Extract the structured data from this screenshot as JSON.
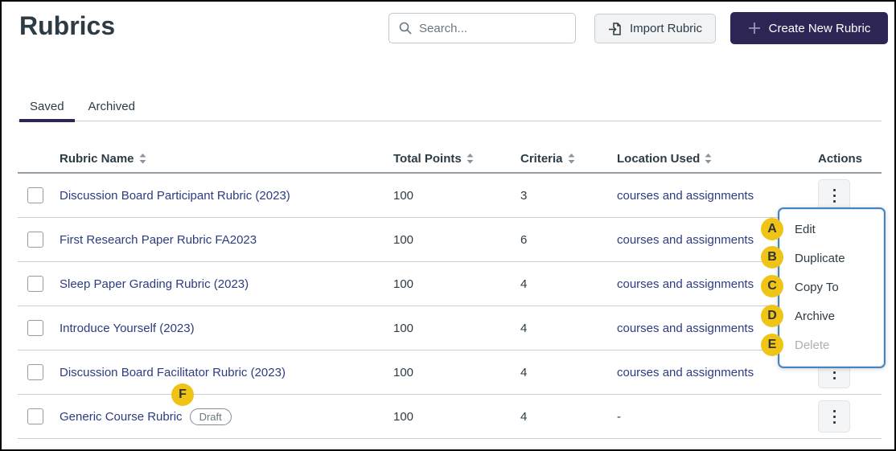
{
  "page": {
    "title": "Rubrics"
  },
  "toolbar": {
    "search_placeholder": "Search...",
    "import_button": "Import Rubric",
    "create_button": "Create New Rubric"
  },
  "tabs": [
    {
      "label": "Saved",
      "active": true
    },
    {
      "label": "Archived",
      "active": false
    }
  ],
  "table": {
    "columns": [
      {
        "label": "Rubric Name",
        "sortable": true
      },
      {
        "label": "Total Points",
        "sortable": true
      },
      {
        "label": "Criteria",
        "sortable": true
      },
      {
        "label": "Location Used",
        "sortable": true
      },
      {
        "label": "Actions",
        "sortable": false
      }
    ],
    "rows": [
      {
        "name": "Discussion Board Participant Rubric (2023)",
        "total_points": "100",
        "criteria": "3",
        "location_used": "courses and assignments"
      },
      {
        "name": "First Research Paper Rubric FA2023",
        "total_points": "100",
        "criteria": "6",
        "location_used": "courses and assignments"
      },
      {
        "name": "Sleep Paper Grading Rubric (2023)",
        "total_points": "100",
        "criteria": "4",
        "location_used": "courses and assignments"
      },
      {
        "name": "Introduce Yourself (2023)",
        "total_points": "100",
        "criteria": "4",
        "location_used": "courses and assignments"
      },
      {
        "name": "Discussion Board Facilitator Rubric (2023)",
        "total_points": "100",
        "criteria": "4",
        "location_used": "courses and assignments"
      },
      {
        "name": "Generic Course Rubric",
        "badge": "Draft",
        "total_points": "100",
        "criteria": "4",
        "location_used": "-"
      }
    ]
  },
  "actions_menu": {
    "items": [
      {
        "label": "Edit",
        "disabled": false
      },
      {
        "label": "Duplicate",
        "disabled": false
      },
      {
        "label": "Copy To",
        "disabled": false
      },
      {
        "label": "Archive",
        "disabled": false
      },
      {
        "label": "Delete",
        "disabled": true
      }
    ]
  },
  "annotations": {
    "markers": [
      {
        "letter": "A",
        "target": "Edit"
      },
      {
        "letter": "B",
        "target": "Duplicate"
      },
      {
        "letter": "C",
        "target": "Copy To"
      },
      {
        "letter": "D",
        "target": "Archive"
      },
      {
        "letter": "E",
        "target": "Delete"
      },
      {
        "letter": "F",
        "target": "Generic Course Rubric"
      }
    ]
  },
  "icons": {
    "search": "magnifier",
    "import": "document-arrow-in",
    "create": "plus",
    "sort": "up-down-arrows",
    "row_actions": "kebab-vertical-dots"
  },
  "colors": {
    "brand_purple": "#2D2655",
    "link_blue": "#2C3C80",
    "menu_focus_blue": "#4285C6",
    "annotation_yellow": "#F0C417",
    "heading_text": "#2D3B45",
    "disabled_text": "#A9B0B6",
    "divider": "#C7CDD1"
  }
}
